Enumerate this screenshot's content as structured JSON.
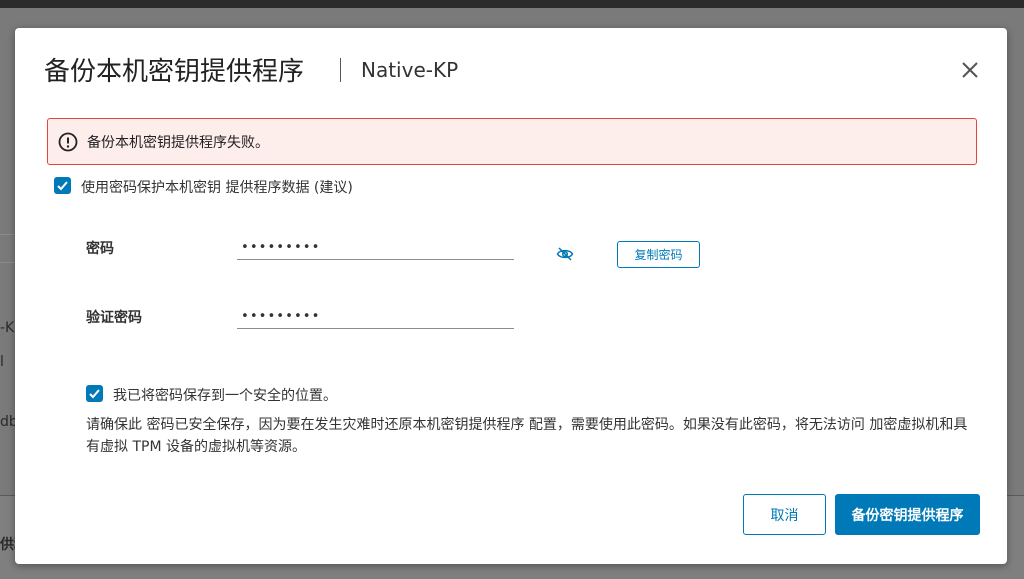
{
  "background": {
    "fragment_1": "-K",
    "fragment_2": "l",
    "fragment_3": "db",
    "fragment_4": "供和"
  },
  "dialog": {
    "title": "备份本机密钥提供程序",
    "subtitle": "Native-KP",
    "close_icon": "close-icon"
  },
  "alert": {
    "icon": "error-circle-icon",
    "message": "备份本机密钥提供程序失败。",
    "border_color": "#e3443c",
    "background_color": "#fdeeec"
  },
  "protect_checkbox": {
    "checked": true,
    "label": "使用密码保护本机密钥 提供程序数据 (建议)"
  },
  "password": {
    "label": "密码",
    "value": "•••••••••",
    "toggle_icon": "eye-hidden-icon",
    "copy_label": "复制密码"
  },
  "confirm_password": {
    "label": "验证密码",
    "value": "•••••••••"
  },
  "saved_checkbox": {
    "checked": true,
    "label": "我已将密码保存到一个安全的位置。"
  },
  "info": {
    "text": "请确保此 密码已安全保存，因为要在发生灾难时还原本机密钥提供程序 配置，需要使用此密码。如果没有此密码，将无法访问 加密虚拟机和具有虚拟 TPM 设备的虚拟机等资源。"
  },
  "footer": {
    "cancel_label": "取消",
    "backup_label": "备份密钥提供程序"
  },
  "colors": {
    "accent": "#0079b8"
  }
}
